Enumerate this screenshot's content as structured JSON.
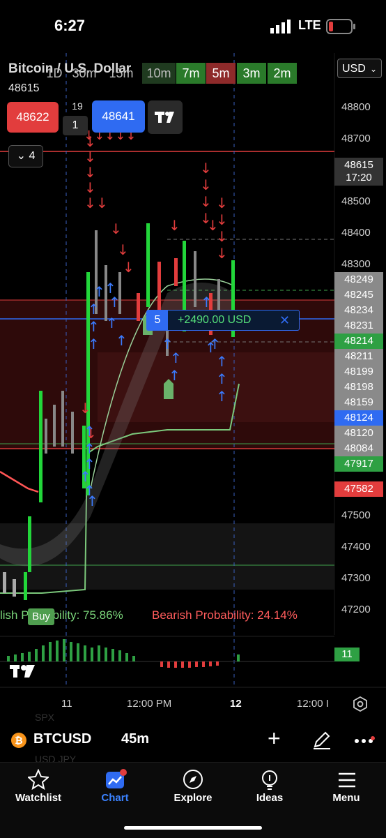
{
  "status": {
    "time": "6:27",
    "network": "LTE"
  },
  "header": {
    "title": "Bitcoin / U.S. Dollar",
    "last_price": "48615",
    "currency": "USD",
    "timeframes": [
      "1D",
      "30m",
      "15m",
      "10m",
      "7m",
      "5m",
      "3m",
      "2m"
    ],
    "active_timeframe": "5m"
  },
  "order": {
    "bid": "48622",
    "spread_top": "19",
    "spread_box": "1",
    "ask": "48641"
  },
  "indicator_toggle": {
    "count": "4"
  },
  "price_axis": {
    "ticks": [
      "48800",
      "48700",
      "48500",
      "48400",
      "48300",
      "47500",
      "47400",
      "47300",
      "47200"
    ],
    "current_price": "48615",
    "countdown": "17:20",
    "labels": [
      {
        "value": "48249",
        "kind": "gray"
      },
      {
        "value": "48245",
        "kind": "gray"
      },
      {
        "value": "48234",
        "kind": "gray"
      },
      {
        "value": "48231",
        "kind": "gray"
      },
      {
        "value": "48214",
        "kind": "green"
      },
      {
        "value": "48211",
        "kind": "gray"
      },
      {
        "value": "48199",
        "kind": "gray"
      },
      {
        "value": "48198",
        "kind": "gray"
      },
      {
        "value": "48159",
        "kind": "gray"
      },
      {
        "value": "48124",
        "kind": "blue"
      },
      {
        "value": "48120",
        "kind": "gray"
      },
      {
        "value": "48084",
        "kind": "gray"
      },
      {
        "value": "47917",
        "kind": "green"
      },
      {
        "value": "47582",
        "kind": "red"
      }
    ]
  },
  "position": {
    "qty": "5",
    "pnl": "+2490.00 USD",
    "close": "✕"
  },
  "probabilities": {
    "bullish": "lish Probability: 75.86%",
    "bearish": "Bearish Probability: 24.14%",
    "buy_label": "Buy"
  },
  "oscillator": {
    "value": "11"
  },
  "time_axis": [
    "11",
    "12:00 PM",
    "12",
    "12:00 I"
  ],
  "symbol_bar": {
    "symbol": "BTCUSD",
    "interval": "45m",
    "ghost_top": "SPX",
    "ghost_bottom": "USD JPY"
  },
  "tabs": [
    {
      "label": "Watchlist",
      "icon": "star-icon"
    },
    {
      "label": "Chart",
      "icon": "chart-icon"
    },
    {
      "label": "Explore",
      "icon": "compass-icon"
    },
    {
      "label": "Ideas",
      "icon": "bulb-icon"
    },
    {
      "label": "Menu",
      "icon": "menu-icon"
    }
  ],
  "colors": {
    "up": "#22d63a",
    "down": "#e23d3d",
    "accent": "#2f6bf2",
    "bg": "#000000"
  }
}
